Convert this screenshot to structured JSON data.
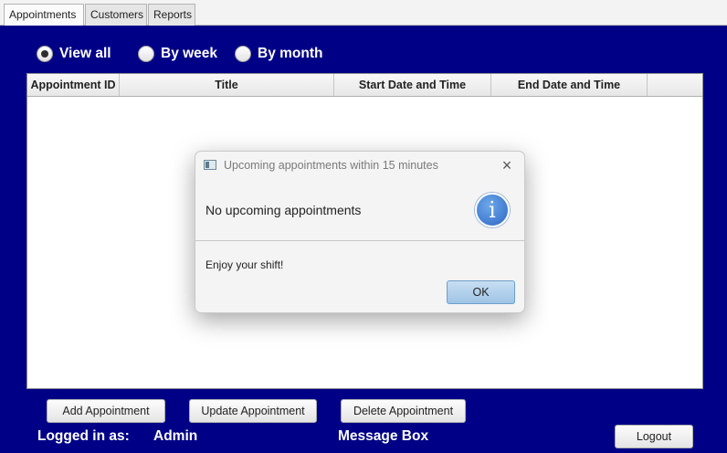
{
  "tabs": [
    {
      "label": "Appointments",
      "active": true
    },
    {
      "label": "Customers",
      "active": false
    },
    {
      "label": "Reports",
      "active": false
    }
  ],
  "filter": {
    "options": [
      {
        "label": "View all",
        "checked": true
      },
      {
        "label": "By week",
        "checked": false
      },
      {
        "label": "By month",
        "checked": false
      }
    ]
  },
  "table": {
    "columns": [
      "Appointment ID",
      "Title",
      "Start Date and Time",
      "End Date and Time"
    ],
    "rows": []
  },
  "buttons": {
    "add": "Add Appointment",
    "update": "Update Appointment",
    "delete": "Delete Appointment",
    "logout": "Logout"
  },
  "footer": {
    "logged_in_label": "Logged in as:",
    "user": "Admin",
    "message_box": "Message Box"
  },
  "dialog": {
    "title": "Upcoming appointments within 15 minutes",
    "header": "No upcoming appointments",
    "content": "Enjoy your shift!",
    "ok_label": "OK",
    "close_glyph": "×",
    "info_glyph": "i"
  },
  "colors": {
    "background": "#000087",
    "ok_button": "#a8cbe9",
    "info_icon": "#2d67c4"
  }
}
